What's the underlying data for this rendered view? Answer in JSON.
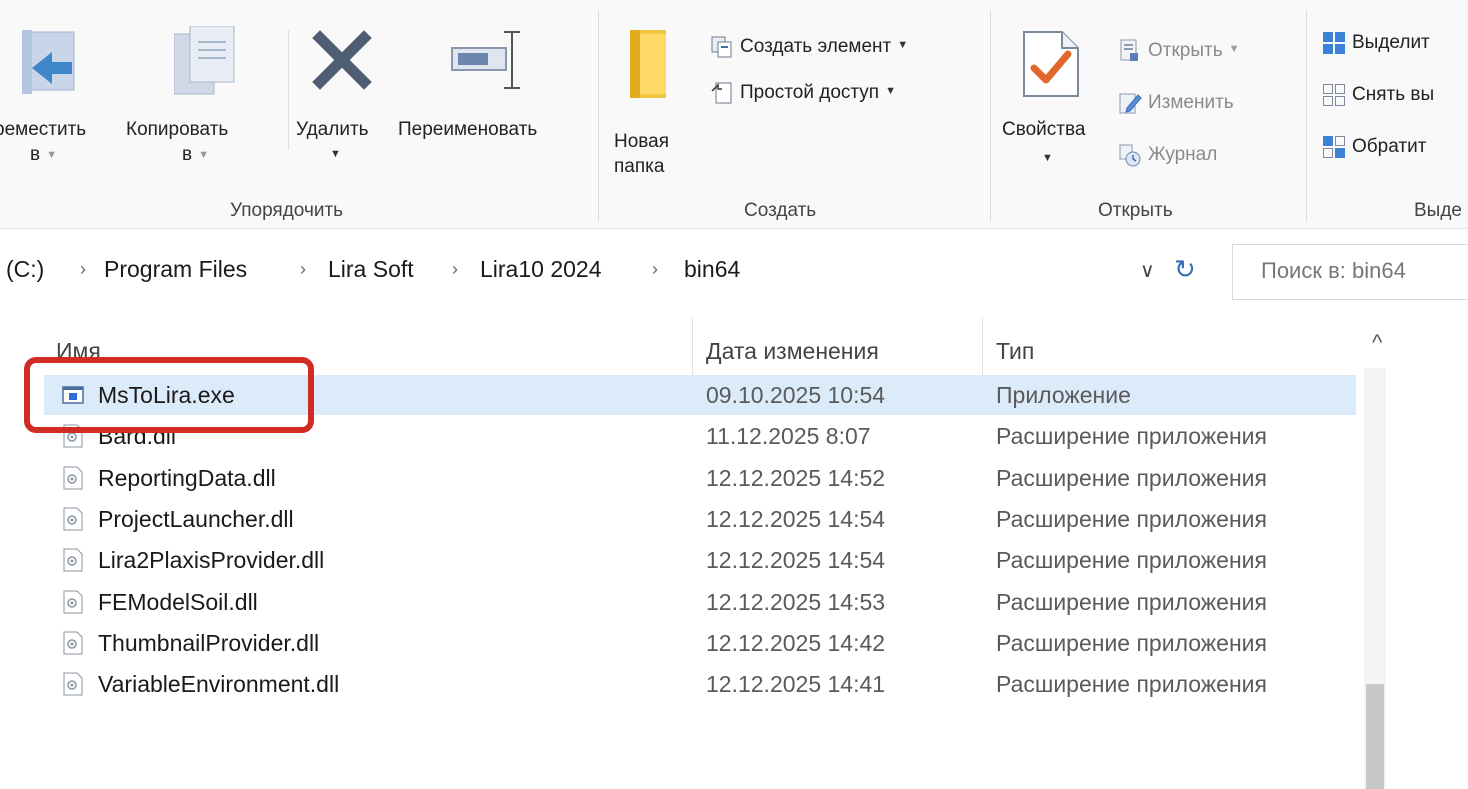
{
  "ribbon": {
    "organize": {
      "label": "Упорядочить",
      "move_to": {
        "line1": "ремеcтить",
        "line2": "в"
      },
      "copy_to": {
        "line1": "Копировать",
        "line2": "в"
      },
      "delete": "Удалить",
      "rename": "Переименовать"
    },
    "create": {
      "label": "Создать",
      "new_item": "Создать элемент",
      "easy_access": "Простой доступ",
      "new_folder": {
        "line1": "Новая",
        "line2": "папка"
      }
    },
    "open": {
      "label": "Открыть",
      "properties": "Свойства",
      "open": "Открыть",
      "edit": "Изменить",
      "history": "Журнал"
    },
    "select": {
      "label": "Выде",
      "select_all": "Выделит",
      "select_none": "Снять вы",
      "invert": "Обратит"
    }
  },
  "address": {
    "crumbs": [
      "(C:)",
      "Program Files",
      "Lira Soft",
      "Lira10 2024",
      "bin64"
    ],
    "search_placeholder": "Поиск в: bin64"
  },
  "columns": {
    "name": "Имя",
    "date": "Дата изменения",
    "type": "Тип"
  },
  "files": [
    {
      "name": "MsToLira.exe",
      "date": "09.10.2025 10:54",
      "type": "Приложение",
      "icon": "exe-icon",
      "selected": true
    },
    {
      "name": "Bard.dll",
      "date": "11.12.2025 8:07",
      "type": "Расширение приложения",
      "icon": "dll-icon"
    },
    {
      "name": "ReportingData.dll",
      "date": "12.12.2025 14:52",
      "type": "Расширение приложения",
      "icon": "dll-icon"
    },
    {
      "name": "ProjectLauncher.dll",
      "date": "12.12.2025 14:54",
      "type": "Расширение приложения",
      "icon": "dll-icon"
    },
    {
      "name": "Lira2PlaxisProvider.dll",
      "date": "12.12.2025 14:54",
      "type": "Расширение приложения",
      "icon": "dll-icon"
    },
    {
      "name": "FEModelSoil.dll",
      "date": "12.12.2025 14:53",
      "type": "Расширение приложения",
      "icon": "dll-icon"
    },
    {
      "name": "ThumbnailProvider.dll",
      "date": "12.12.2025 14:42",
      "type": "Расширение приложения",
      "icon": "dll-icon"
    },
    {
      "name": "VariableEnvironment.dll",
      "date": "12.12.2025 14:41",
      "type": "Расширение приложения",
      "icon": "dll-icon"
    }
  ],
  "colors": {
    "selection": "#dcebfa",
    "highlight_box": "#d02c24",
    "accent": "#1f6fd1"
  }
}
